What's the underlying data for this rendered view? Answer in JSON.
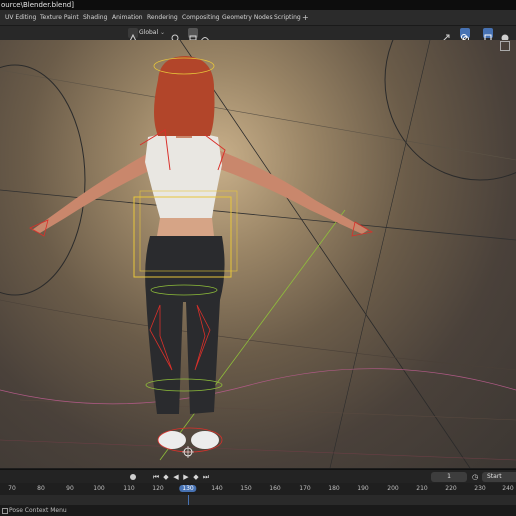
{
  "window": {
    "title": "ource\\Blender.blend]"
  },
  "workspace_tabs": [
    "UV Editing",
    "Texture Paint",
    "Shading",
    "Animation",
    "Rendering",
    "Compositing",
    "Geometry Nodes",
    "Scripting"
  ],
  "workspace_add_label": "+",
  "header": {
    "orientation_label": "Global"
  },
  "timeline": {
    "current_frame": "1",
    "start_label": "Start",
    "ruler_ticks": [
      "70",
      "80",
      "90",
      "100",
      "110",
      "120",
      "130",
      "140",
      "150",
      "160",
      "170",
      "180",
      "190",
      "200",
      "210",
      "220",
      "230",
      "240"
    ],
    "current_tick": "130"
  },
  "status": {
    "text": "Pose Context Menu"
  },
  "colors": {
    "accent": "#4772b3",
    "selection": "#e8c63a",
    "rig": "#d9302a",
    "hair": "#b2452a",
    "top": "#e9e7e2",
    "jeans": "#2a2b2e"
  }
}
